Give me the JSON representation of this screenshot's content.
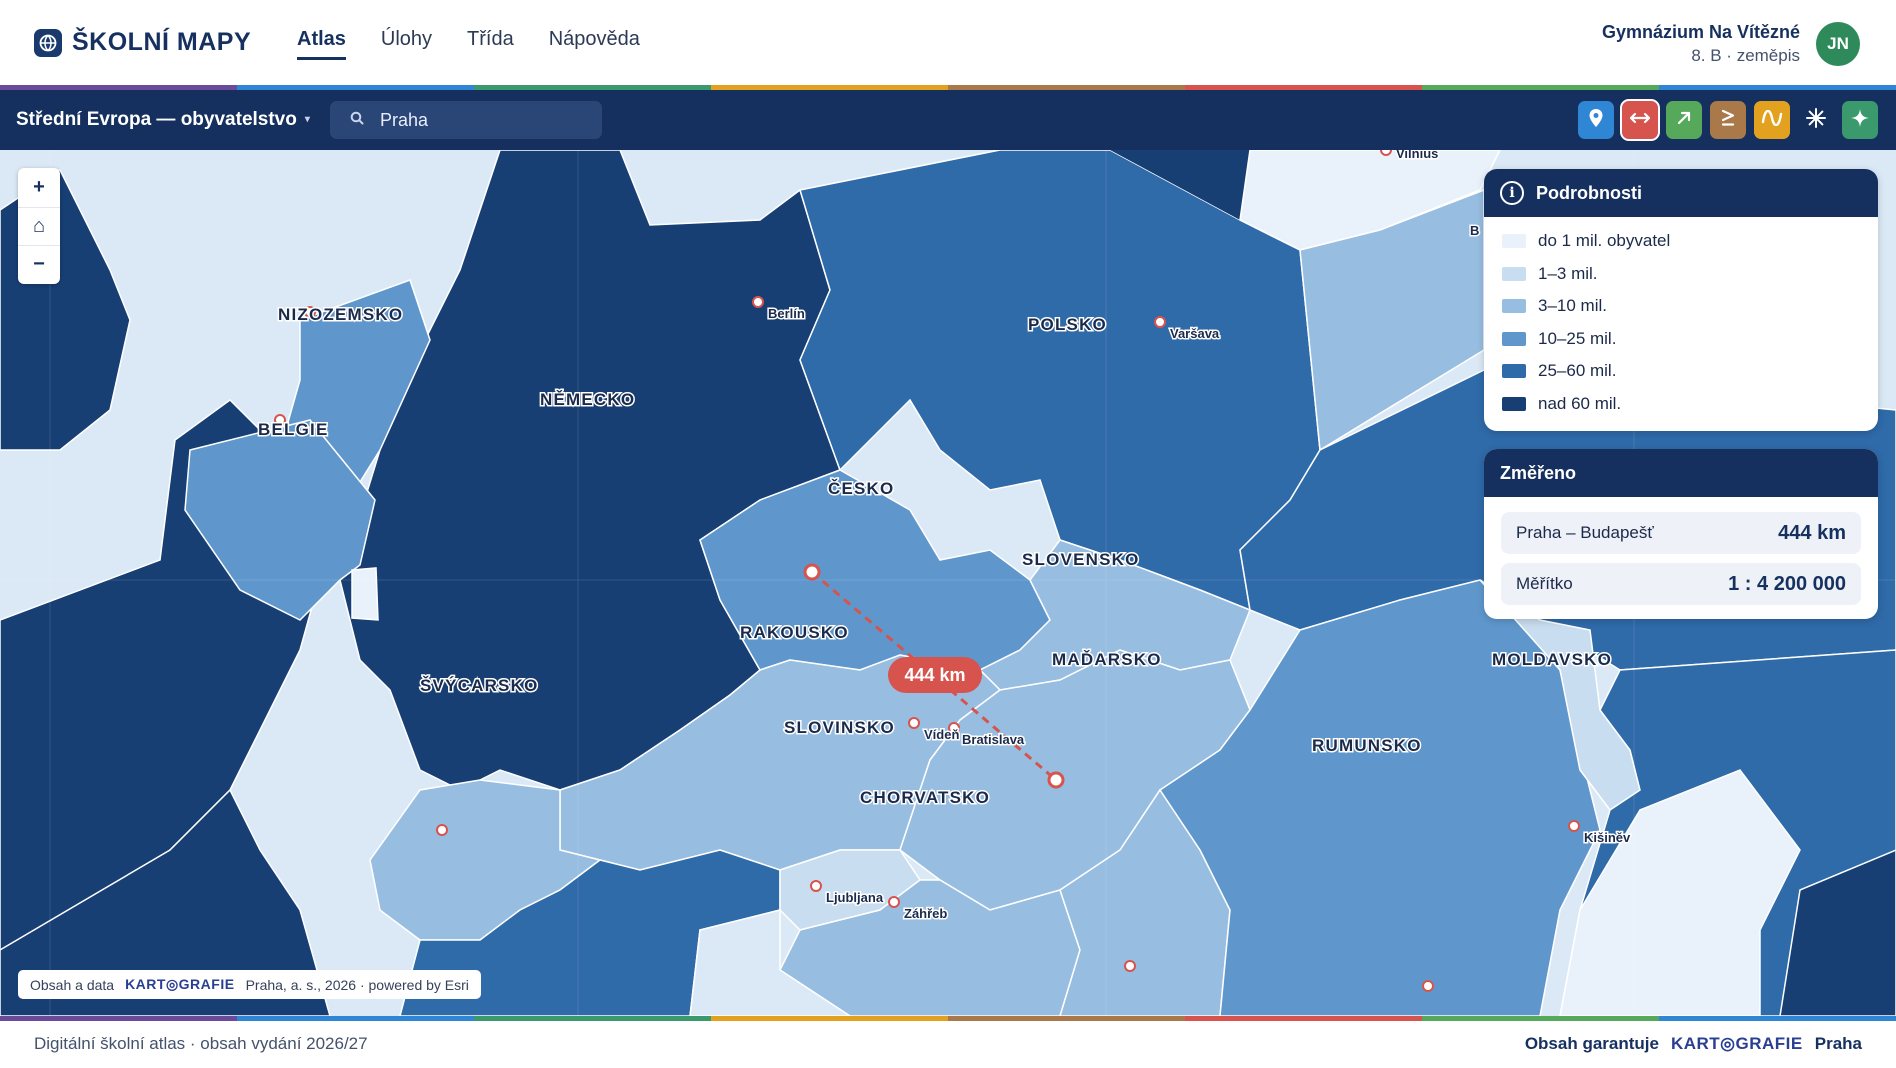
{
  "app": {
    "brand": "ŠKOLNÍ MAPY"
  },
  "nav": {
    "tabs": [
      {
        "label": "Atlas",
        "active": true
      },
      {
        "label": "Úlohy"
      },
      {
        "label": "Třída"
      },
      {
        "label": "Nápověda"
      }
    ]
  },
  "user": {
    "school": "Gymnázium Na Vítězné",
    "class_line": "8. B · zeměpis",
    "initials": "JN"
  },
  "toolbar": {
    "layer_title": "Střední Evropa — obyvatelstvo",
    "caret": "▾",
    "search_value": "Praha",
    "tools": [
      {
        "icon": "pin-icon",
        "color": "#2f86d4"
      },
      {
        "icon": "measure-distance-icon",
        "color": "#d6544d",
        "selected": true
      },
      {
        "icon": "arrow-up-right-icon",
        "color": "#56a85b"
      },
      {
        "icon": "greater-equal-icon",
        "color": "#a9794a"
      },
      {
        "icon": "wave-icon",
        "color": "#e2a21f"
      },
      {
        "icon": "sun-icon",
        "color": "#15305e"
      },
      {
        "icon": "sparkle-icon",
        "color": "#3a9a6e"
      }
    ]
  },
  "map": {
    "zoom": {
      "in": "+",
      "home": "⌂",
      "out": "−"
    },
    "countries": [
      "NIZOZEMSKO",
      "BELGIE",
      "NĚMECKO",
      "POLSKO",
      "ČESKO",
      "SLOVENSKO",
      "RAKOUSKO",
      "MAĎARSKO",
      "ŠVÝCARSKO",
      "SLOVINSKO",
      "CHORVATSKO",
      "RUMUNSKO",
      "MOLDAVSKO"
    ],
    "cities": [
      "Berlín",
      "Varšava",
      "Vilnius",
      "Vídeň",
      "Bratislava",
      "Ljubljana",
      "Záhřeb",
      "Kišiněv"
    ],
    "edge_letter": "B",
    "distance_badge": "444 km",
    "attribution": {
      "prefix": "Obsah a data",
      "brand": "KART◎GRAFIE",
      "suffix": "Praha, a. s., 2026 · powered by Esri"
    }
  },
  "legend": {
    "title": "Podrobnosti",
    "items": [
      {
        "label": "do 1 mil. obyvatel",
        "color": "#e9f2fb"
      },
      {
        "label": "1–3 mil.",
        "color": "#c9ddf0"
      },
      {
        "label": "3–10 mil.",
        "color": "#97bde1"
      },
      {
        "label": "10–25 mil.",
        "color": "#5f97cc"
      },
      {
        "label": "25–60 mil.",
        "color": "#2f6aa9"
      },
      {
        "label": "nad 60 mil.",
        "color": "#183f74"
      }
    ]
  },
  "measure": {
    "title": "Změřeno",
    "rows": [
      {
        "label": "Praha – Budapešť",
        "value": "444 km"
      },
      {
        "label": "Měřítko",
        "value": "1 : 4 200 000"
      }
    ]
  },
  "footer": {
    "left": "Digitální školní atlas · obsah vydání 2026/27",
    "right_prefix": "Obsah garantuje",
    "right_brand": "KART◎GRAFIE",
    "right_suffix": "Praha"
  },
  "colors": {
    "stripe": [
      "#6b4a9b",
      "#2f86d4",
      "#3a9a6e",
      "#e2a21f",
      "#a9794a",
      "#d6544d",
      "#56a85b",
      "#2f86d4"
    ]
  }
}
